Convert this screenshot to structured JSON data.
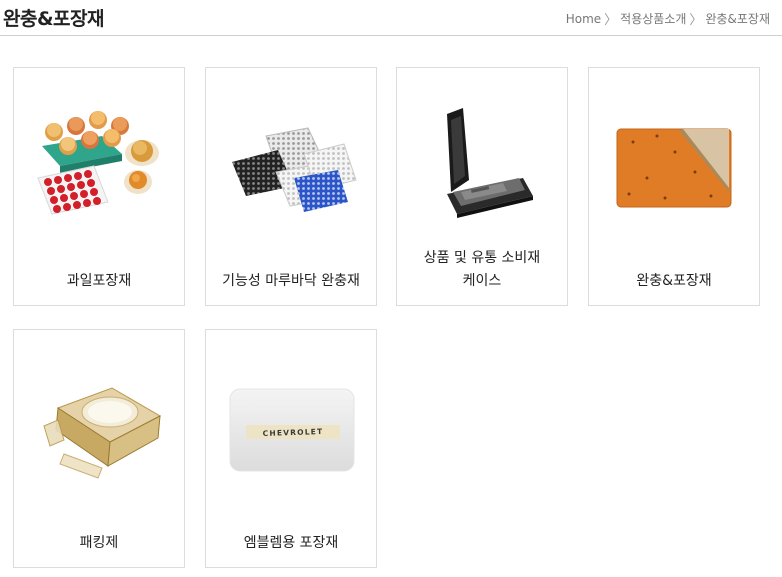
{
  "page": {
    "title": "완충&포장재"
  },
  "breadcrumb": {
    "items": [
      "Home",
      "적용상품소개",
      "완충&포장재"
    ],
    "separator": "〉"
  },
  "products": [
    {
      "label_lines": [
        "과일포장재"
      ],
      "icon": "fruit-tray-image"
    },
    {
      "label_lines": [
        "기능성 마루바닥 완충재"
      ],
      "icon": "floor-cushion-sheet-image"
    },
    {
      "label_lines": [
        "상품 및 유통 소비재",
        "케이스"
      ],
      "icon": "product-case-image"
    },
    {
      "label_lines": [
        "완충&포장재"
      ],
      "icon": "cushion-board-image"
    },
    {
      "label_lines": [
        "패킹제"
      ],
      "icon": "cosmetic-packing-image"
    },
    {
      "label_lines": [
        "엠블렘용 포장재"
      ],
      "icon": "emblem-packaging-image",
      "emblem_text": "CHEVROLET"
    }
  ]
}
